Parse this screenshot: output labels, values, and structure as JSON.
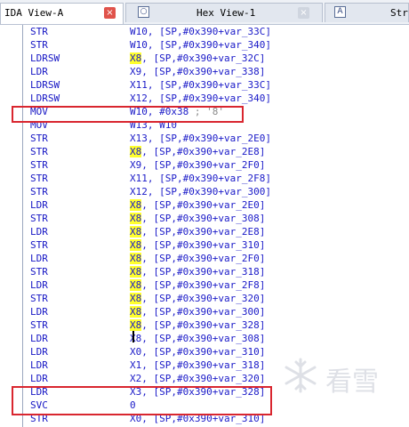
{
  "tabs": [
    {
      "label": "IDA View-A",
      "active": true,
      "icon": "",
      "close": "×"
    },
    {
      "label": "Hex View-1",
      "active": false,
      "icon": "○",
      "close": "×"
    },
    {
      "label": "Str",
      "active": false,
      "icon": "A",
      "close": ""
    }
  ],
  "watermark": {
    "text": "看雪",
    "icon": "snowflake-icon"
  },
  "colors": {
    "mnemonic": "#1515c4",
    "highlight": "#ffff2e",
    "redbox": "#d9262f"
  },
  "lines": [
    {
      "mnem": "STR",
      "reg": "W10",
      "hl": false,
      "rest": ", [SP,#0x390+var_33C]"
    },
    {
      "mnem": "STR",
      "reg": "W10",
      "hl": false,
      "rest": ", [SP,#0x390+var_340]"
    },
    {
      "mnem": "LDRSW",
      "reg": "X8",
      "hl": true,
      "rest": ", [SP,#0x390+var_32C]"
    },
    {
      "mnem": "LDR",
      "reg": "X9",
      "hl": false,
      "rest": ", [SP,#0x390+var_338]"
    },
    {
      "mnem": "LDRSW",
      "reg": "X11",
      "hl": false,
      "rest": ", [SP,#0x390+var_33C]"
    },
    {
      "mnem": "LDRSW",
      "reg": "X12",
      "hl": false,
      "rest": ", [SP,#0x390+var_340]"
    },
    {
      "mnem": "MOV",
      "reg": "W10",
      "hl": false,
      "rest": ", #0x38 ",
      "comment": "; '8'"
    },
    {
      "mnem": "MOV",
      "reg": "W13",
      "hl": false,
      "rest": ", W10"
    },
    {
      "mnem": "STR",
      "reg": "X13",
      "hl": false,
      "rest": ", [SP,#0x390+var_2E0]"
    },
    {
      "mnem": "STR",
      "reg": "X8",
      "hl": true,
      "rest": ", [SP,#0x390+var_2E8]"
    },
    {
      "mnem": "STR",
      "reg": "X9",
      "hl": false,
      "rest": ", [SP,#0x390+var_2F0]"
    },
    {
      "mnem": "STR",
      "reg": "X11",
      "hl": false,
      "rest": ", [SP,#0x390+var_2F8]"
    },
    {
      "mnem": "STR",
      "reg": "X12",
      "hl": false,
      "rest": ", [SP,#0x390+var_300]"
    },
    {
      "mnem": "LDR",
      "reg": "X8",
      "hl": true,
      "rest": ", [SP,#0x390+var_2E0]"
    },
    {
      "mnem": "STR",
      "reg": "X8",
      "hl": true,
      "rest": ", [SP,#0x390+var_308]"
    },
    {
      "mnem": "LDR",
      "reg": "X8",
      "hl": true,
      "rest": ", [SP,#0x390+var_2E8]"
    },
    {
      "mnem": "STR",
      "reg": "X8",
      "hl": true,
      "rest": ", [SP,#0x390+var_310]"
    },
    {
      "mnem": "LDR",
      "reg": "X8",
      "hl": true,
      "rest": ", [SP,#0x390+var_2F0]"
    },
    {
      "mnem": "STR",
      "reg": "X8",
      "hl": true,
      "rest": ", [SP,#0x390+var_318]"
    },
    {
      "mnem": "LDR",
      "reg": "X8",
      "hl": true,
      "rest": ", [SP,#0x390+var_2F8]"
    },
    {
      "mnem": "STR",
      "reg": "X8",
      "hl": true,
      "rest": ", [SP,#0x390+var_320]"
    },
    {
      "mnem": "LDR",
      "reg": "X8",
      "hl": true,
      "rest": ", [SP,#0x390+var_300]"
    },
    {
      "mnem": "STR",
      "reg": "X8",
      "hl": true,
      "rest": ", [SP,#0x390+var_328]"
    },
    {
      "mnem": "LDR",
      "reg": "X8",
      "hl": false,
      "rest": ", [SP,#0x390+var_308]"
    },
    {
      "mnem": "LDR",
      "reg": "X0",
      "hl": false,
      "rest": ", [SP,#0x390+var_310]"
    },
    {
      "mnem": "LDR",
      "reg": "X1",
      "hl": false,
      "rest": ", [SP,#0x390+var_318]"
    },
    {
      "mnem": "LDR",
      "reg": "X2",
      "hl": false,
      "rest": ", [SP,#0x390+var_320]"
    },
    {
      "mnem": "LDR",
      "reg": "X3",
      "hl": false,
      "rest": ", [SP,#0x390+var_328]"
    },
    {
      "mnem": "SVC",
      "reg": "0",
      "hl": false,
      "rest": ""
    },
    {
      "mnem": "STR",
      "reg": "X0",
      "hl": false,
      "rest": ", [SP,#0x390+var_310]"
    }
  ]
}
